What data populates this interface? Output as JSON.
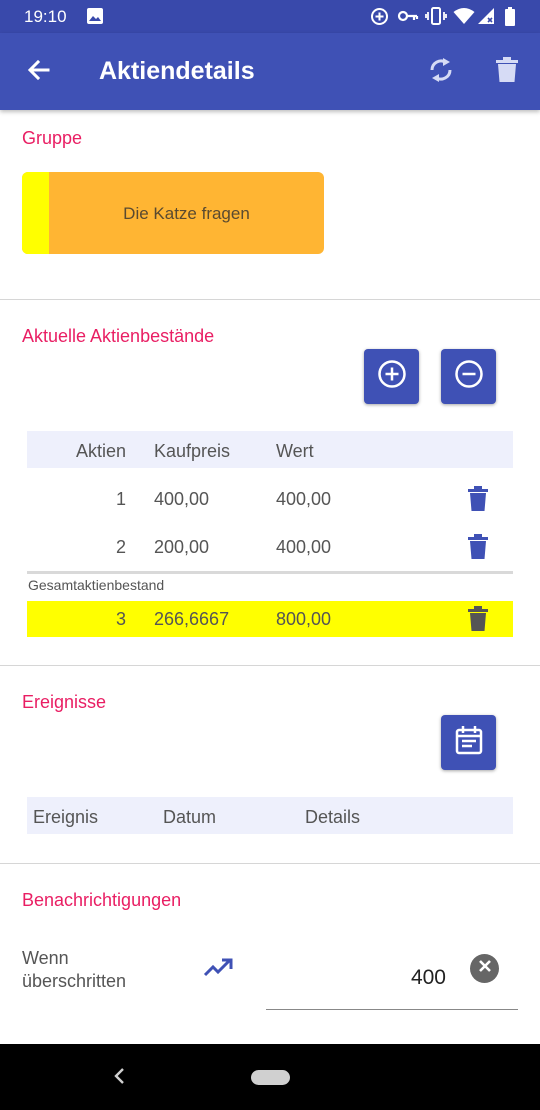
{
  "status_bar": {
    "time": "19:10",
    "icons": [
      "image-icon",
      "data-saver-icon",
      "vpn-key-icon",
      "vibrate-icon",
      "wifi-icon",
      "signal-icon",
      "battery-icon"
    ]
  },
  "app_bar": {
    "title": "Aktiendetails",
    "back_icon": "arrow-back-icon",
    "refresh_icon": "sync-icon",
    "delete_icon": "trash-icon"
  },
  "group": {
    "section_title": "Gruppe",
    "card_label": "Die Katze fragen",
    "card_color": "#ffb533",
    "stripe_color": "#ffff00"
  },
  "holdings": {
    "section_title": "Aktuelle Aktienbestände",
    "add_icon": "add-circle-icon",
    "remove_icon": "remove-circle-icon",
    "columns": [
      "Aktien",
      "Kaufpreis",
      "Wert"
    ],
    "rows": [
      {
        "shares": "1",
        "price": "400,00",
        "value": "400,00"
      },
      {
        "shares": "2",
        "price": "200,00",
        "value": "400,00"
      }
    ],
    "total_caption": "Gesamtaktienbestand",
    "total": {
      "shares": "3",
      "price": "266,6667",
      "value": "800,00"
    }
  },
  "events": {
    "section_title": "Ereignisse",
    "calendar_icon": "calendar-icon",
    "columns": [
      "Ereignis",
      "Datum",
      "Details"
    ]
  },
  "notifications": {
    "section_title": "Benachrichtigungen",
    "label_line1": "Wenn",
    "label_line2": "überschritten",
    "trend_icon": "trending-up-icon",
    "value": "400",
    "clear_icon": "clear-icon"
  },
  "colors": {
    "primary": "#3f51b5",
    "primary_dark": "#3949ab",
    "accent": "#e91e63",
    "highlight": "#ffff00"
  }
}
